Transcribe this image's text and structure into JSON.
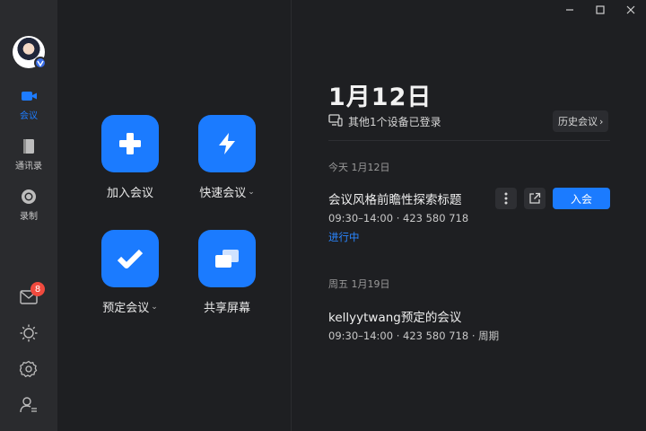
{
  "window": {
    "minimize_icon": "minimize-icon",
    "maximize_icon": "maximize-icon",
    "close_icon": "close-icon"
  },
  "sidebar": {
    "nav": [
      {
        "label": "会议",
        "icon": "video-camera-icon",
        "active": true
      },
      {
        "label": "通讯录",
        "icon": "contacts-book-icon",
        "active": false
      },
      {
        "label": "录制",
        "icon": "record-icon",
        "active": false
      }
    ],
    "mail_badge": "8",
    "bottom_icons": [
      "mail-icon",
      "sun-theme-icon",
      "gear-icon",
      "user-settings-icon"
    ]
  },
  "actions": {
    "join": "加入会议",
    "quick": "快速会议",
    "schedule": "预定会议",
    "share": "共享屏幕",
    "caret": "⌄"
  },
  "header": {
    "date": "1月12日",
    "login_notice": "其他1个设备已登录",
    "history_label": "历史会议",
    "history_arrow": "›"
  },
  "meetings": {
    "today_label": "今天 1月12日",
    "today": {
      "title": "会议风格前瞻性探索标题",
      "time": "09:30–14:00 · 423 580 718",
      "status": "进行中",
      "join_label": "入会"
    },
    "friday_label": "周五 1月19日",
    "friday": {
      "title": "kellyytwang预定的会议",
      "time": "09:30–14:00 · 423 580 718 · 周期"
    }
  },
  "colors": {
    "accent": "#1b7bff",
    "badge": "#f04a3e",
    "status": "#2a86ff"
  }
}
